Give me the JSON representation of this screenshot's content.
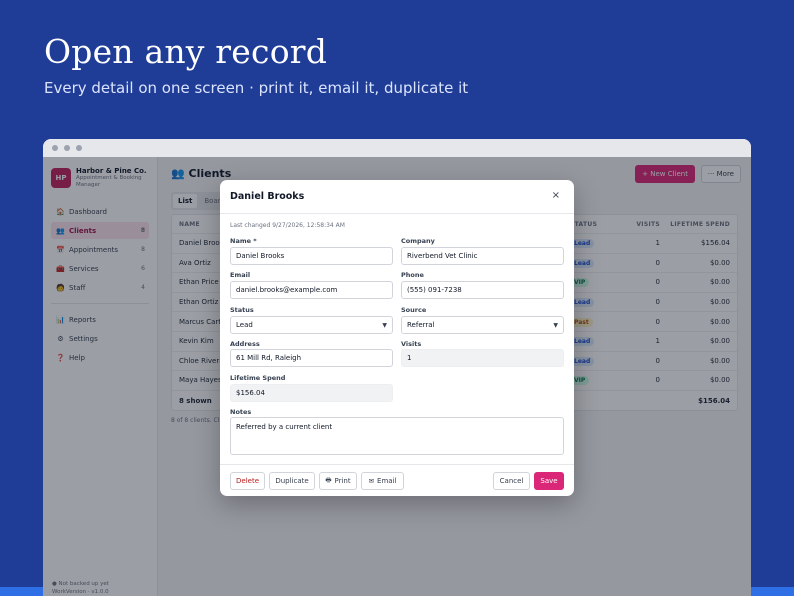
{
  "hero": {
    "title": "Open any record",
    "subtitle": "Every detail on one screen · print it, email it, duplicate it"
  },
  "sidebar": {
    "brand_initials": "HP",
    "brand_name": "Harbor & Pine Co.",
    "brand_subtitle": "Appointment & Booking Manager",
    "items": [
      {
        "label": "Dashboard",
        "icon": "home-icon",
        "glyph": "🏠",
        "count": ""
      },
      {
        "label": "Clients",
        "icon": "people-icon",
        "glyph": "👥",
        "count": "8",
        "active": true
      },
      {
        "label": "Appointments",
        "icon": "calendar-icon",
        "glyph": "📅",
        "count": "8"
      },
      {
        "label": "Services",
        "icon": "services-icon",
        "glyph": "🧰",
        "count": "6"
      },
      {
        "label": "Staff",
        "icon": "staff-icon",
        "glyph": "🧑",
        "count": "4"
      }
    ],
    "secondary_items": [
      {
        "label": "Reports",
        "icon": "chart-icon",
        "glyph": "📊"
      },
      {
        "label": "Settings",
        "icon": "gear-icon",
        "glyph": "⚙"
      },
      {
        "label": "Help",
        "icon": "help-icon",
        "glyph": "❓"
      }
    ],
    "footer_line1": "● Not backed up yet",
    "footer_line2": "WorkVersion · v1.0.0"
  },
  "page": {
    "title": "👥 Clients",
    "new_button": "+ New Client",
    "more_button": "··· More",
    "tabs": [
      "List",
      "Board"
    ],
    "columns": {
      "name": "NAME",
      "status": "STATUS",
      "visits": "VISITS",
      "spend": "LIFETIME SPEND"
    },
    "rows": [
      {
        "name": "Daniel Brooks",
        "status": "Lead",
        "status_type": "lead",
        "visits": "1",
        "spend": "$156.04"
      },
      {
        "name": "Ava Ortiz",
        "status": "Lead",
        "status_type": "lead",
        "visits": "0",
        "spend": "$0.00"
      },
      {
        "name": "Ethan Price",
        "status": "VIP",
        "status_type": "vip",
        "visits": "0",
        "spend": "$0.00"
      },
      {
        "name": "Ethan Ortiz",
        "status": "Lead",
        "status_type": "lead",
        "visits": "0",
        "spend": "$0.00"
      },
      {
        "name": "Marcus Carter",
        "status": "Past",
        "status_type": "past",
        "visits": "0",
        "spend": "$0.00"
      },
      {
        "name": "Kevin Kim",
        "status": "Lead",
        "status_type": "lead",
        "visits": "1",
        "spend": "$0.00"
      },
      {
        "name": "Chloe Rivera",
        "status": "Lead",
        "status_type": "lead",
        "visits": "0",
        "spend": "$0.00"
      },
      {
        "name": "Maya Hayes",
        "status": "VIP",
        "status_type": "vip",
        "visits": "0",
        "spend": "$0.00"
      }
    ],
    "footer_label": "8 shown",
    "footer_total": "$156.04",
    "caption": "8 of 8 clients. Cli"
  },
  "modal": {
    "title": "Daniel Brooks",
    "close": "×",
    "last_changed": "Last changed 9/27/2026, 12:58:34 AM",
    "fields": {
      "name_label": "Name *",
      "name_value": "Daniel Brooks",
      "company_label": "Company",
      "company_value": "Riverbend Vet Clinic",
      "email_label": "Email",
      "email_value": "daniel.brooks@example.com",
      "phone_label": "Phone",
      "phone_value": "(555) 091-7238",
      "status_label": "Status",
      "status_value": "Lead",
      "source_label": "Source",
      "source_value": "Referral",
      "address_label": "Address",
      "address_value": "61 Mill Rd, Raleigh",
      "visits_label": "Visits",
      "visits_value": "1",
      "spend_label": "Lifetime Spend",
      "spend_value": "$156.04",
      "notes_label": "Notes",
      "notes_value": "Referred by a current client"
    },
    "buttons": {
      "delete": "Delete",
      "duplicate": "Duplicate",
      "print": "Print",
      "email": "Email",
      "cancel": "Cancel",
      "save": "Save"
    }
  },
  "colors": {
    "background": "#1f3c96",
    "accent": "#db2777",
    "bottom_bar": "#2f6fe6"
  }
}
